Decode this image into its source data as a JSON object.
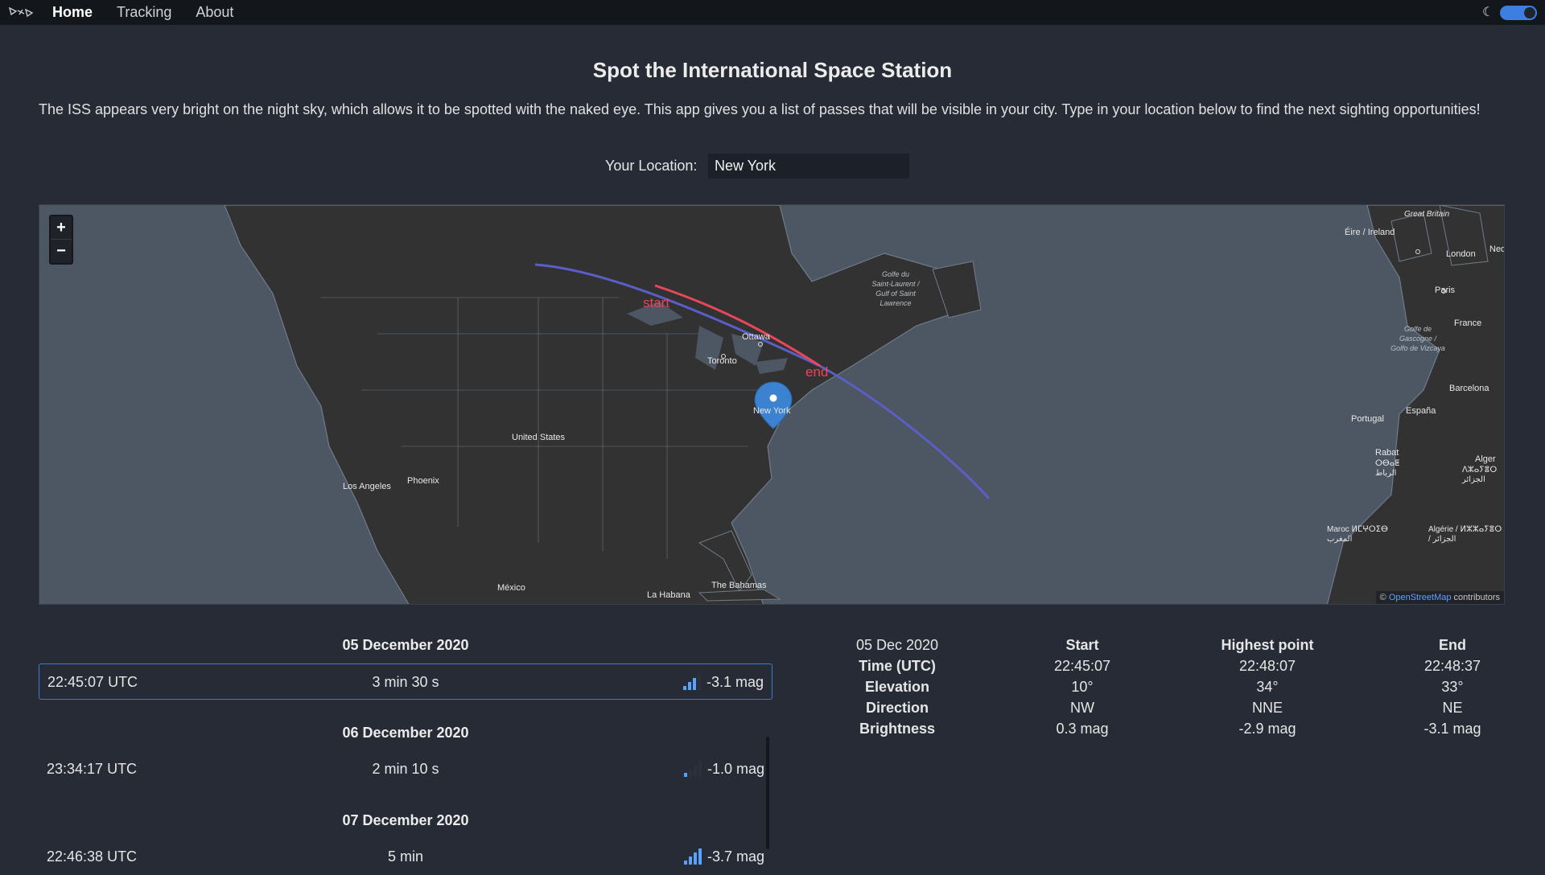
{
  "nav": {
    "links": [
      "Home",
      "Tracking",
      "About"
    ],
    "active": "Home",
    "theme_toggle_state": "dark"
  },
  "header": {
    "title": "Spot the International Space Station",
    "intro": "The ISS appears very bright on the night sky, which allows it to be spotted with the naked eye. This app gives you a list of passes that will be visible in your city. Type in your location below to find the next sighting opportunities!"
  },
  "location": {
    "label": "Your Location:",
    "value": "New York"
  },
  "map": {
    "zoom_in": "+",
    "zoom_out": "−",
    "labels": {
      "start": "start",
      "end": "end",
      "marker_city": "New York",
      "ottawa": "Ottawa",
      "toronto": "Toronto",
      "united_states": "United States",
      "phoenix": "Phoenix",
      "los_angeles": "Los Angeles",
      "mexico": "México",
      "la_habana": "La Habana",
      "bahamas": "The Bahamas",
      "golfe": "Golfe du Saint-Laurent / Gulf of Saint Lawrence",
      "great_britain": "Great Britain",
      "eire": "Éire / Ireland",
      "london": "London",
      "neder": "Neder",
      "paris": "Paris",
      "france": "France",
      "golfe_gasc": "Golfe de Gascogne / Golfo de Vizcaya",
      "portugal": "Portugal",
      "espana": "España",
      "barcelona": "Barcelona",
      "rabat": "Rabat",
      "rabat_ar": "ⵔⴱⴰⵟ الرباط",
      "alger": "Alger",
      "alger_ar": "ⴷⵣⴰⵢⴻⵔ الجزائر",
      "maroc": "Maroc ⵍⵎⵖⵔⵉⴱ المغرب",
      "algerie": "Algérie / ⵍⵣⵣⴰⵢⴻⵔ / الجزائر"
    },
    "attribution_prefix": "© ",
    "attribution_link": "OpenStreetMap",
    "attribution_suffix": " contributors",
    "colors": {
      "visible_track": "#e8475a",
      "orbit_track": "#5a5fc8",
      "marker": "#3b82d0"
    }
  },
  "passes": [
    {
      "date": "05 December 2020",
      "time": "22:45:07 UTC",
      "duration": "3 min 30 s",
      "magnitude": "-3.1 mag",
      "signal_level": 3,
      "selected": true
    },
    {
      "date": "06 December 2020",
      "time": "23:34:17 UTC",
      "duration": "2 min 10 s",
      "magnitude": "-1.0 mag",
      "signal_level": 1,
      "selected": false
    },
    {
      "date": "07 December 2020",
      "time": "22:46:38 UTC",
      "duration": "5 min",
      "magnitude": "-3.7 mag",
      "signal_level": 4,
      "selected": false
    }
  ],
  "details": {
    "date": "05 Dec 2020",
    "headers": [
      "Start",
      "Highest point",
      "End"
    ],
    "rows": [
      {
        "label": "Time (UTC)",
        "values": [
          "22:45:07",
          "22:48:07",
          "22:48:37"
        ]
      },
      {
        "label": "Elevation",
        "values": [
          "10°",
          "34°",
          "33°"
        ]
      },
      {
        "label": "Direction",
        "values": [
          "NW",
          "NNE",
          "NE"
        ]
      },
      {
        "label": "Brightness",
        "values": [
          "0.3 mag",
          "-2.9 mag",
          "-3.1 mag"
        ]
      }
    ]
  }
}
